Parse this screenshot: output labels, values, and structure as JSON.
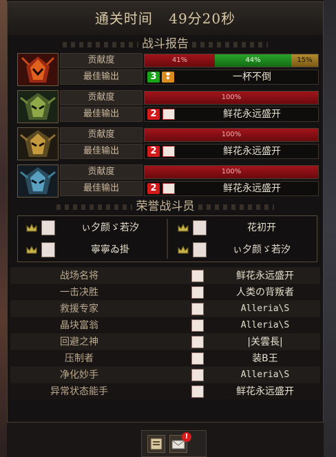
{
  "header": {
    "clear_time_label": "通关时间",
    "clear_time_value": "49分20秒"
  },
  "battle_report": {
    "title": "战斗报告",
    "contribution_label": "贡献度",
    "best_output_label": "最佳输出",
    "players": [
      {
        "portrait": "crimson-helm",
        "contribution": [
          {
            "text": "41%",
            "value": 41,
            "color": "red"
          },
          {
            "text": "44%",
            "value": 44,
            "color": "green"
          },
          {
            "text": "15%",
            "value": 15,
            "color": "gold"
          }
        ],
        "best_rank": "3",
        "best_name": "一杯不倒"
      },
      {
        "portrait": "green-helm",
        "contribution": [
          {
            "text": "100%",
            "value": 100,
            "color": "red"
          }
        ],
        "best_rank": "2",
        "best_name": "鲜花永远盛开"
      },
      {
        "portrait": "gold-helm",
        "contribution": [
          {
            "text": "100%",
            "value": 100,
            "color": "red"
          }
        ],
        "best_rank": "2",
        "best_name": "鲜花永远盛开"
      },
      {
        "portrait": "blue-helm",
        "contribution": [
          {
            "text": "100%",
            "value": 100,
            "color": "red"
          }
        ],
        "best_rank": "2",
        "best_name": "鲜花永远盛开"
      }
    ]
  },
  "honor": {
    "title": "荣誉战斗员",
    "members": [
      "ぃ夕颜ゞ若汐",
      "花初开",
      "寧寧ゐ掛",
      "ぃ夕颜ゞ若汐"
    ]
  },
  "awards": [
    {
      "label": "战场名将",
      "name": "鲜花永远盛开"
    },
    {
      "label": "一击决胜",
      "name": "人类の背叛者"
    },
    {
      "label": "救援专家",
      "name": "Alleria\\S"
    },
    {
      "label": "晶块富翁",
      "name": "Alleria\\S"
    },
    {
      "label": "回避之神",
      "name": "|关雲長|"
    },
    {
      "label": "压制者",
      "name": "装B王"
    },
    {
      "label": "净化妙手",
      "name": "Alleria\\S"
    },
    {
      "label": "异常状态能手",
      "name": "鲜花永远盛开"
    }
  ],
  "bottom_bar": {
    "mail_notification": "!"
  },
  "colors": {
    "bar_red": "#a1141a",
    "bar_green": "#2aa42a",
    "bar_gold": "#b48a2c"
  }
}
